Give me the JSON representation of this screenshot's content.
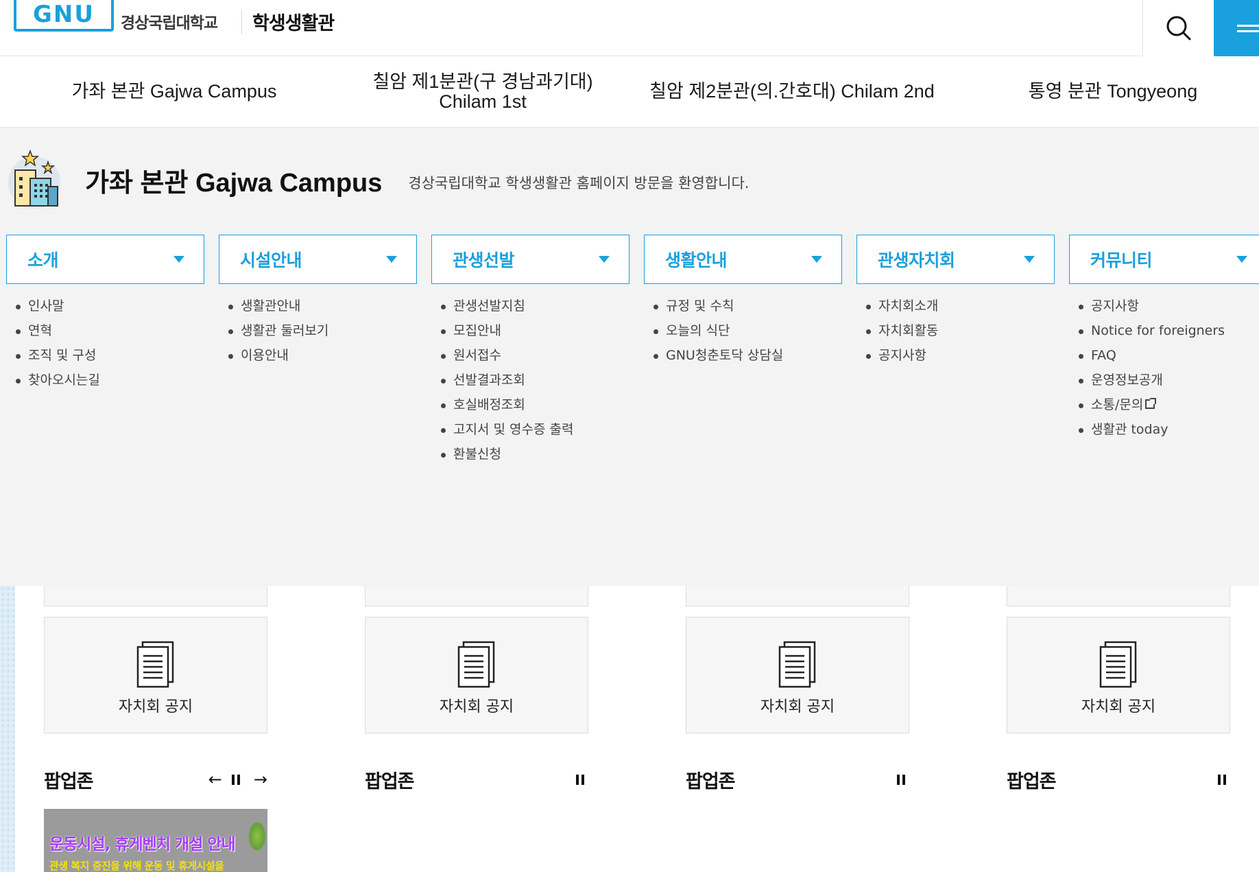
{
  "header": {
    "logo_mark": "GNU",
    "university": "경상국립대학교",
    "site_title": "학생생활관"
  },
  "campus_tabs": [
    "가좌 본관 Gajwa Campus",
    "칠암 제1분관(구 경남과기대) Chilam 1st",
    "칠암 제2분관(의.간호대) Chilam 2nd",
    "통영 분관 Tongyeong"
  ],
  "mega": {
    "campus_title": "가좌 본관 Gajwa Campus",
    "welcome": "경상국립대학교 학생생활관 홈페이지 방문을 환영합니다.",
    "columns": [
      {
        "title": "소개",
        "items": [
          "인사말",
          "연혁",
          "조직 및 구성",
          "찾아오시는길"
        ]
      },
      {
        "title": "시설안내",
        "items": [
          "생활관안내",
          "생활관 둘러보기",
          "이용안내"
        ]
      },
      {
        "title": "관생선발",
        "items": [
          "관생선발지침",
          "모집안내",
          "원서접수",
          "선발결과조회",
          "호실배정조회",
          "고지서 및 영수증 출력",
          "환불신청"
        ]
      },
      {
        "title": "생활안내",
        "items": [
          "규정 및 수칙",
          "오늘의 식단",
          "GNU청춘토닥 상담실"
        ]
      },
      {
        "title": "관생자치회",
        "items": [
          "자치회소개",
          "자치회활동",
          "공지사항"
        ]
      },
      {
        "title": "커뮤니티",
        "items": [
          "공지사항",
          "Notice for foreigners",
          "FAQ",
          "운영정보공개",
          "소통/문의",
          "생활관 today"
        ]
      }
    ]
  },
  "panels": [
    {
      "card_label": "자치회 공지",
      "popup_title": "팝업존",
      "has_arrows": true
    },
    {
      "card_label": "자치회 공지",
      "popup_title": "팝업존",
      "has_arrows": false
    },
    {
      "card_label": "자치회 공지",
      "popup_title": "팝업존",
      "has_arrows": false
    },
    {
      "card_label": "자치회 공지",
      "popup_title": "팝업존",
      "has_arrows": false
    }
  ],
  "popup_banner": {
    "line1": "운동시설, 휴게벤치 개설 안내",
    "line2": "관생 복지 증진을 위해 운동 및 휴게시설을"
  },
  "icons": {
    "search": "search-icon",
    "menu": "hamburger-menu-icon",
    "campus": "campus-building-icon",
    "caret": "caret-down-icon",
    "document": "document-icon",
    "prev": "arrow-left-icon",
    "pause": "pause-icon",
    "next": "arrow-right-icon",
    "external": "external-link-icon"
  },
  "colors": {
    "accent": "#1aa0dc",
    "menu_bg": "#f3f3f3",
    "banner_text": "#a63cff",
    "banner_subtext": "#f3e20c"
  }
}
